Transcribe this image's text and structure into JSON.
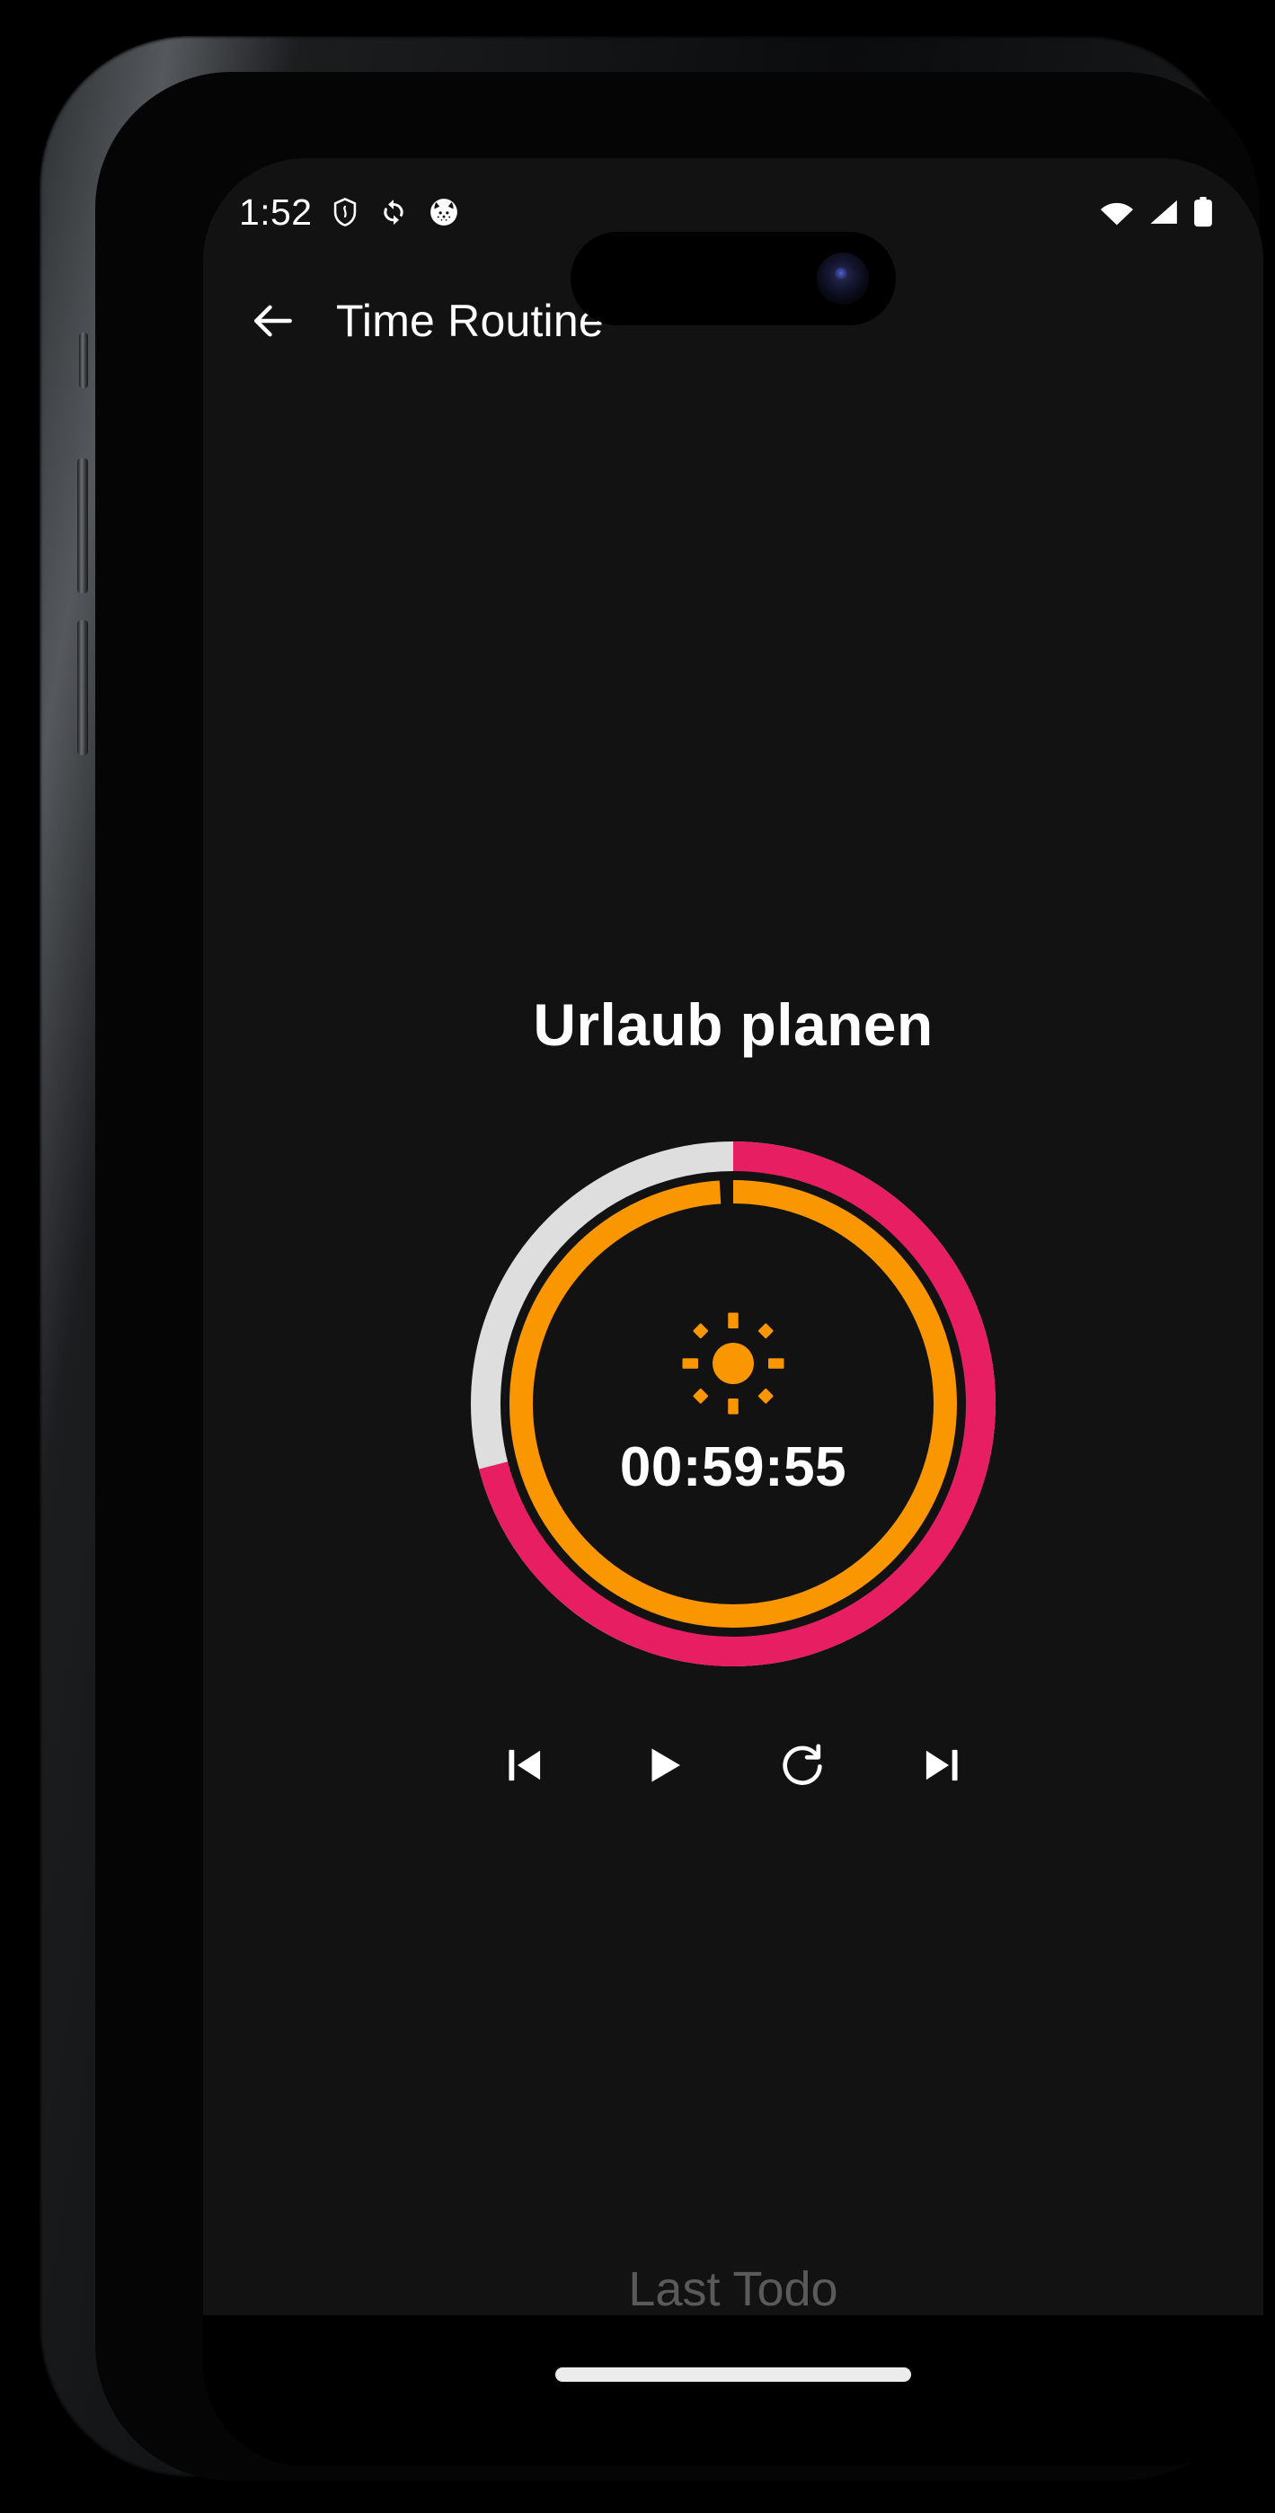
{
  "status_bar": {
    "clock": "1:52",
    "left_icons": [
      {
        "name": "shield-icon",
        "label": "shield"
      },
      {
        "name": "sync-icon",
        "label": "sync"
      },
      {
        "name": "app-notification-icon",
        "label": "app"
      }
    ],
    "right_icons": [
      {
        "name": "wifi-icon",
        "label": "wifi"
      },
      {
        "name": "cellular-signal-icon",
        "label": "signal"
      },
      {
        "name": "battery-icon",
        "label": "battery"
      }
    ]
  },
  "app_bar": {
    "back_label": "back",
    "title": "Time Routine"
  },
  "main": {
    "routine_title": "Urlaub planen",
    "timer_value": "00:59:55",
    "center_icon": "sun-icon",
    "last_todo_label": "Last Todo"
  },
  "controls": [
    {
      "name": "skip-previous-button",
      "label": "Previous"
    },
    {
      "name": "play-button",
      "label": "Play"
    },
    {
      "name": "restart-button",
      "label": "Restart"
    },
    {
      "name": "skip-next-button",
      "label": "Next"
    }
  ],
  "ring": {
    "outer_progress_percent": 71,
    "outer_remaining_percent": 29,
    "inner_progress_percent": 99,
    "outer_progress_color": "#E81E63",
    "outer_track_color": "#DEDEDE",
    "inner_progress_color": "#FA9600",
    "accent_color": "#FA9600",
    "background_color": "#121212"
  }
}
